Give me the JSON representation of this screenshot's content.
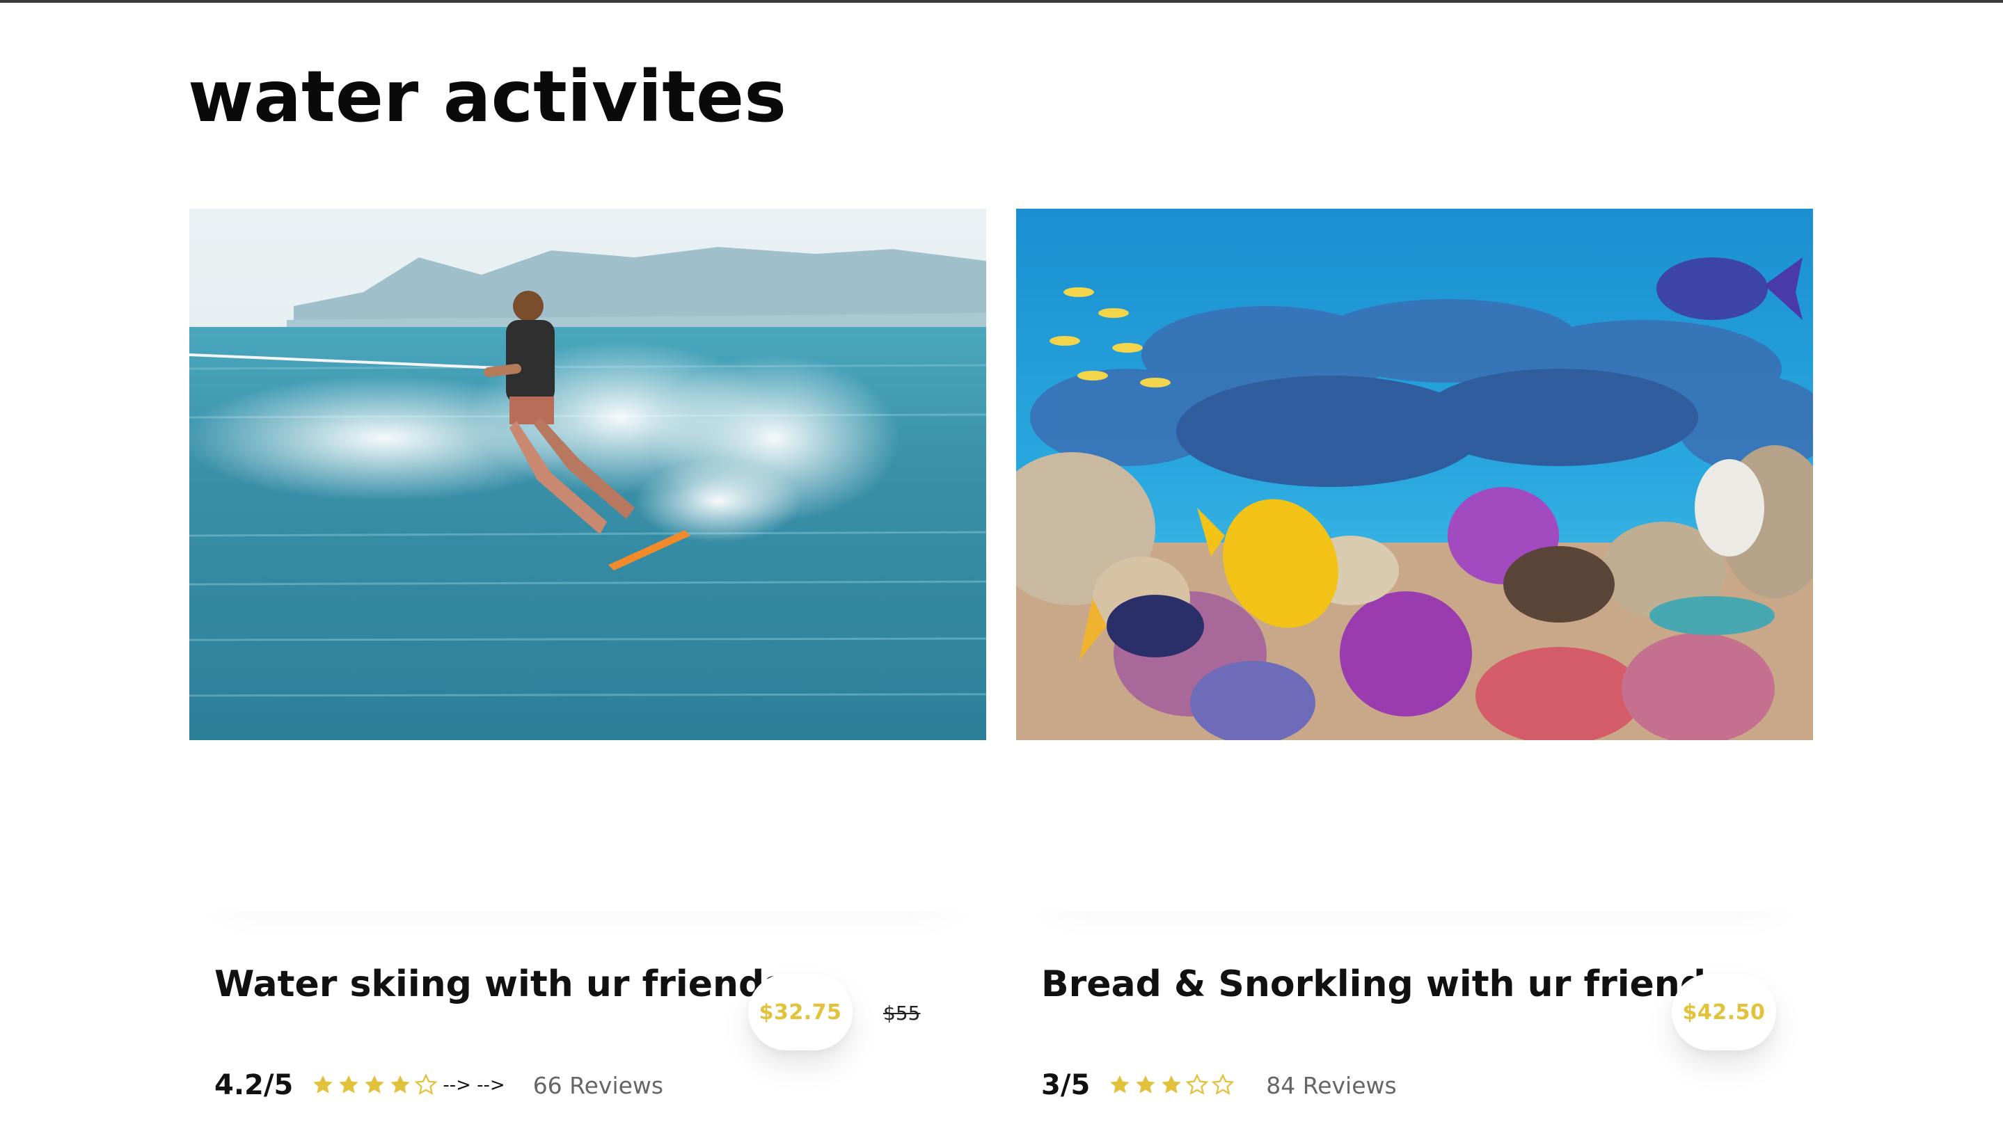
{
  "section": {
    "title": "water activites"
  },
  "colors": {
    "price": "#e2c23a",
    "star_filled": "#e2c23a",
    "rule": "#3a3a3a"
  },
  "activities": [
    {
      "name": "Water skiing with ur friends",
      "price": "$32.75",
      "old_price": "$55",
      "rating": "4.2/5",
      "stars_filled": 4,
      "stars_total": 5,
      "artifact_text": "--> -->",
      "reviews": "66 Reviews",
      "image_icon": "water-skier-photo"
    },
    {
      "name": "Bread & Snorkling with ur friends",
      "price": "$42.50",
      "rating": "3/5",
      "stars_filled": 3,
      "stars_total": 5,
      "reviews": "84 Reviews",
      "image_icon": "coral-reef-photo"
    }
  ]
}
